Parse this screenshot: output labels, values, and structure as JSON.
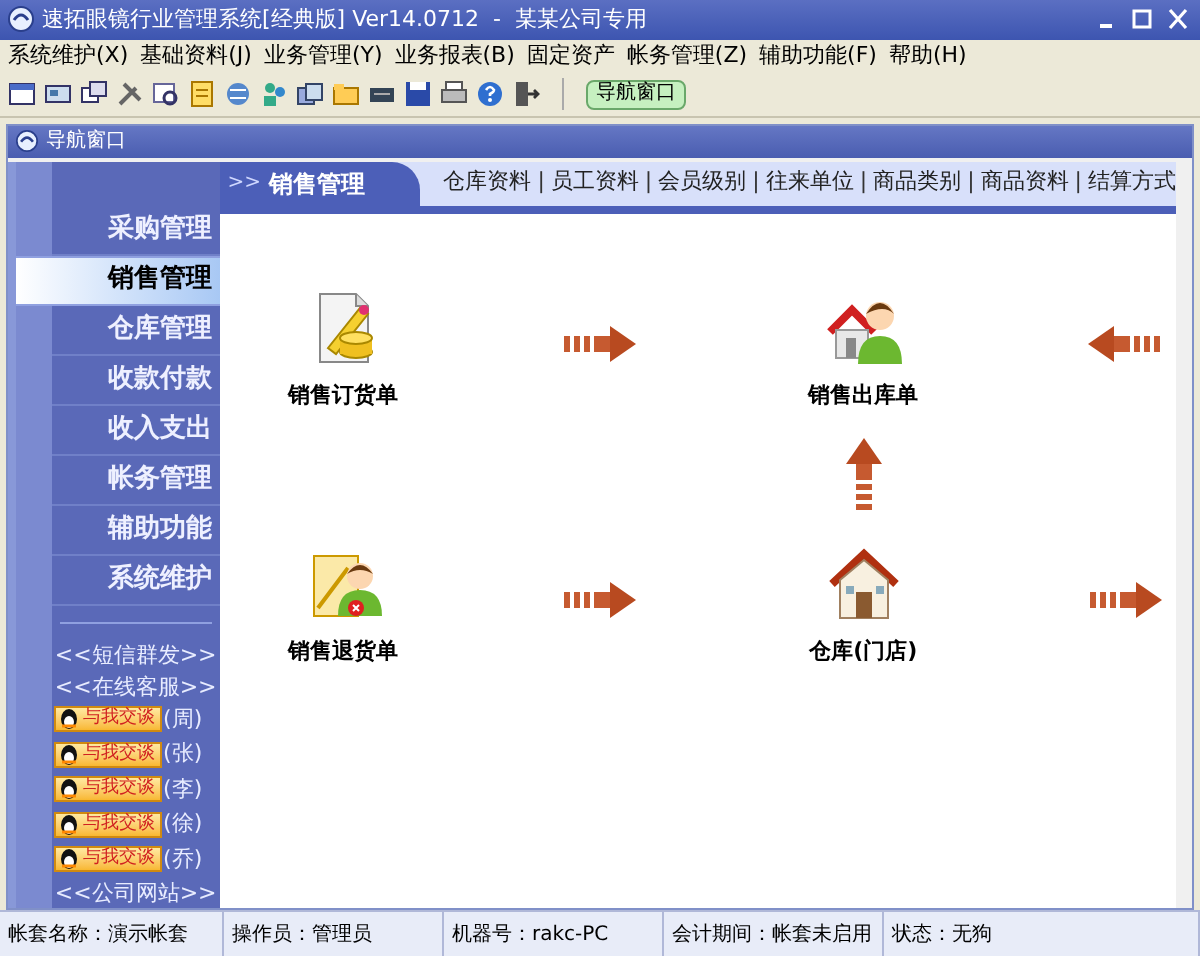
{
  "window": {
    "title": "速拓眼镜行业管理系统[经典版] Ver14.0712  -  某某公司专用"
  },
  "menu": [
    "系统维护(X)",
    "基础资料(J)",
    "业务管理(Y)",
    "业务报表(B)",
    "固定资产",
    "帐务管理(Z)",
    "辅助功能(F)",
    "帮助(H)"
  ],
  "toolbar": {
    "button": "导航窗口"
  },
  "nav_window": {
    "title": "导航窗口"
  },
  "sidebar": {
    "items": [
      {
        "label": "采购管理",
        "selected": false
      },
      {
        "label": "销售管理",
        "selected": true
      },
      {
        "label": "仓库管理",
        "selected": false
      },
      {
        "label": "收款付款",
        "selected": false
      },
      {
        "label": "收入支出",
        "selected": false
      },
      {
        "label": "帐务管理",
        "selected": false
      },
      {
        "label": "辅助功能",
        "selected": false
      },
      {
        "label": "系统维护",
        "selected": false
      }
    ],
    "links_top": [
      "<<短信群发>>",
      "<<在线客服>>"
    ],
    "chat_buttons": [
      {
        "label": "与我交谈",
        "name": "(周)"
      },
      {
        "label": "与我交谈",
        "name": "(张)"
      },
      {
        "label": "与我交谈",
        "name": "(李)"
      },
      {
        "label": "与我交谈",
        "name": "(徐)"
      },
      {
        "label": "与我交谈",
        "name": "(乔)"
      }
    ],
    "links_bottom": [
      "<<公司网站>>"
    ]
  },
  "header": {
    "prefix": ">>",
    "title": "销售管理",
    "links": [
      "仓库资料",
      "员工资料",
      "会员级别",
      "往来单位",
      "商品类别",
      "商品资料",
      "结算方式"
    ],
    "separator": "|"
  },
  "flow": {
    "nodes": [
      {
        "kind": "order",
        "label": "销售订货单"
      },
      {
        "kind": "outbound",
        "label": "销售出库单"
      },
      {
        "kind": "return",
        "label": "销售退货单"
      },
      {
        "kind": "store",
        "label": "仓库(门店)"
      }
    ]
  },
  "status_bar": [
    "帐套名称：演示帐套",
    "操作员：管理员",
    "机器号：rakc-PC",
    "会计期间：帐套未启用",
    "状态：无狗"
  ]
}
